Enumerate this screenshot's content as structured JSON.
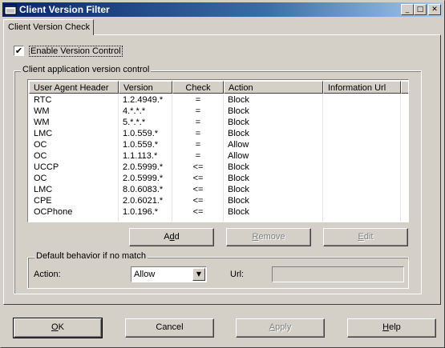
{
  "window": {
    "title": "Client Version Filter",
    "controls": {
      "minimize": "_",
      "maximize": "□",
      "close": "✕"
    }
  },
  "tabs": [
    {
      "label": "Client Version Check",
      "active": true
    }
  ],
  "enable_control": {
    "label": "Enable Version Control",
    "checked": true,
    "check_glyph": "✔"
  },
  "version_group": {
    "legend": "Client application version control",
    "columns": [
      "User Agent Header",
      "Version",
      "Check",
      "Action",
      "Information Url"
    ],
    "rows": [
      {
        "agent": "RTC",
        "version": "1.2.4949.*",
        "check": "=",
        "action": "Block",
        "url": ""
      },
      {
        "agent": "WM",
        "version": "4.*.*.*",
        "check": "=",
        "action": "Block",
        "url": ""
      },
      {
        "agent": "WM",
        "version": "5.*.*.*",
        "check": "=",
        "action": "Block",
        "url": ""
      },
      {
        "agent": "LMC",
        "version": "1.0.559.*",
        "check": "=",
        "action": "Block",
        "url": ""
      },
      {
        "agent": "OC",
        "version": "1.0.559.*",
        "check": "=",
        "action": "Allow",
        "url": ""
      },
      {
        "agent": "OC",
        "version": "1.1.113.*",
        "check": "=",
        "action": "Allow",
        "url": ""
      },
      {
        "agent": "UCCP",
        "version": "2.0.5999.*",
        "check": "<=",
        "action": "Block",
        "url": ""
      },
      {
        "agent": "OC",
        "version": "2.0.5999.*",
        "check": "<=",
        "action": "Block",
        "url": ""
      },
      {
        "agent": "LMC",
        "version": "8.0.6083.*",
        "check": "<=",
        "action": "Block",
        "url": ""
      },
      {
        "agent": "CPE",
        "version": "2.0.6021.*",
        "check": "<=",
        "action": "Block",
        "url": ""
      },
      {
        "agent": "OCPhone",
        "version": "1.0.196.*",
        "check": "<=",
        "action": "Block",
        "url": ""
      }
    ],
    "buttons": {
      "add": {
        "pre": "A",
        "key": "d",
        "post": "d",
        "enabled": true
      },
      "remove": {
        "pre": "",
        "key": "R",
        "post": "emove",
        "enabled": false
      },
      "edit": {
        "pre": "",
        "key": "E",
        "post": "dit",
        "enabled": false
      }
    }
  },
  "default_behavior": {
    "legend": "Default behavior if no match",
    "action_label": "Action:",
    "action_value": "Allow",
    "url_label": "Url:",
    "url_value": ""
  },
  "footer": {
    "ok": {
      "pre": "",
      "key": "O",
      "post": "K",
      "enabled": true
    },
    "cancel": {
      "label": "Cancel",
      "enabled": true
    },
    "apply": {
      "pre": "",
      "key": "A",
      "post": "pply",
      "enabled": false
    },
    "help": {
      "pre": "",
      "key": "H",
      "post": "elp",
      "enabled": true
    }
  }
}
